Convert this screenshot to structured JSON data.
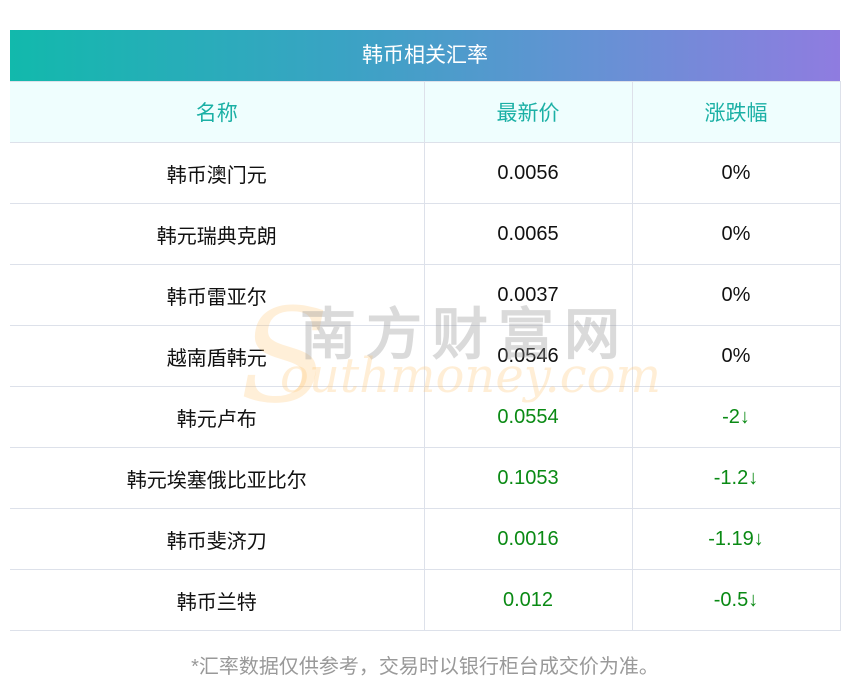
{
  "title": "韩币相关汇率",
  "headers": [
    "名称",
    "最新价",
    "涨跌幅"
  ],
  "rows": [
    {
      "name": "韩币澳门元",
      "price": "0.0056",
      "change": "0%",
      "down": false
    },
    {
      "name": "韩元瑞典克朗",
      "price": "0.0065",
      "change": "0%",
      "down": false
    },
    {
      "name": "韩币雷亚尔",
      "price": "0.0037",
      "change": "0%",
      "down": false
    },
    {
      "name": "越南盾韩元",
      "price": "0.0546",
      "change": "0%",
      "down": false
    },
    {
      "name": "韩元卢布",
      "price": "0.0554",
      "change": "-2↓",
      "down": true
    },
    {
      "name": "韩元埃塞俄比亚比尔",
      "price": "0.1053",
      "change": "-1.2↓",
      "down": true
    },
    {
      "name": "韩币斐济刀",
      "price": "0.0016",
      "change": "-1.19↓",
      "down": true
    },
    {
      "name": "韩币兰特",
      "price": "0.012",
      "change": "-0.5↓",
      "down": true
    }
  ],
  "footer": "*汇率数据仅供参考，交易时以银行柜台成交价为准。",
  "watermark": {
    "cn": "南方财富网",
    "en": "outhmoney.com",
    "s": "S"
  },
  "colors": {
    "down": "#0a8a14",
    "header_text": "#1bb0a5",
    "gradient_start": "#12b9ac",
    "gradient_end": "#8f7ce0"
  }
}
